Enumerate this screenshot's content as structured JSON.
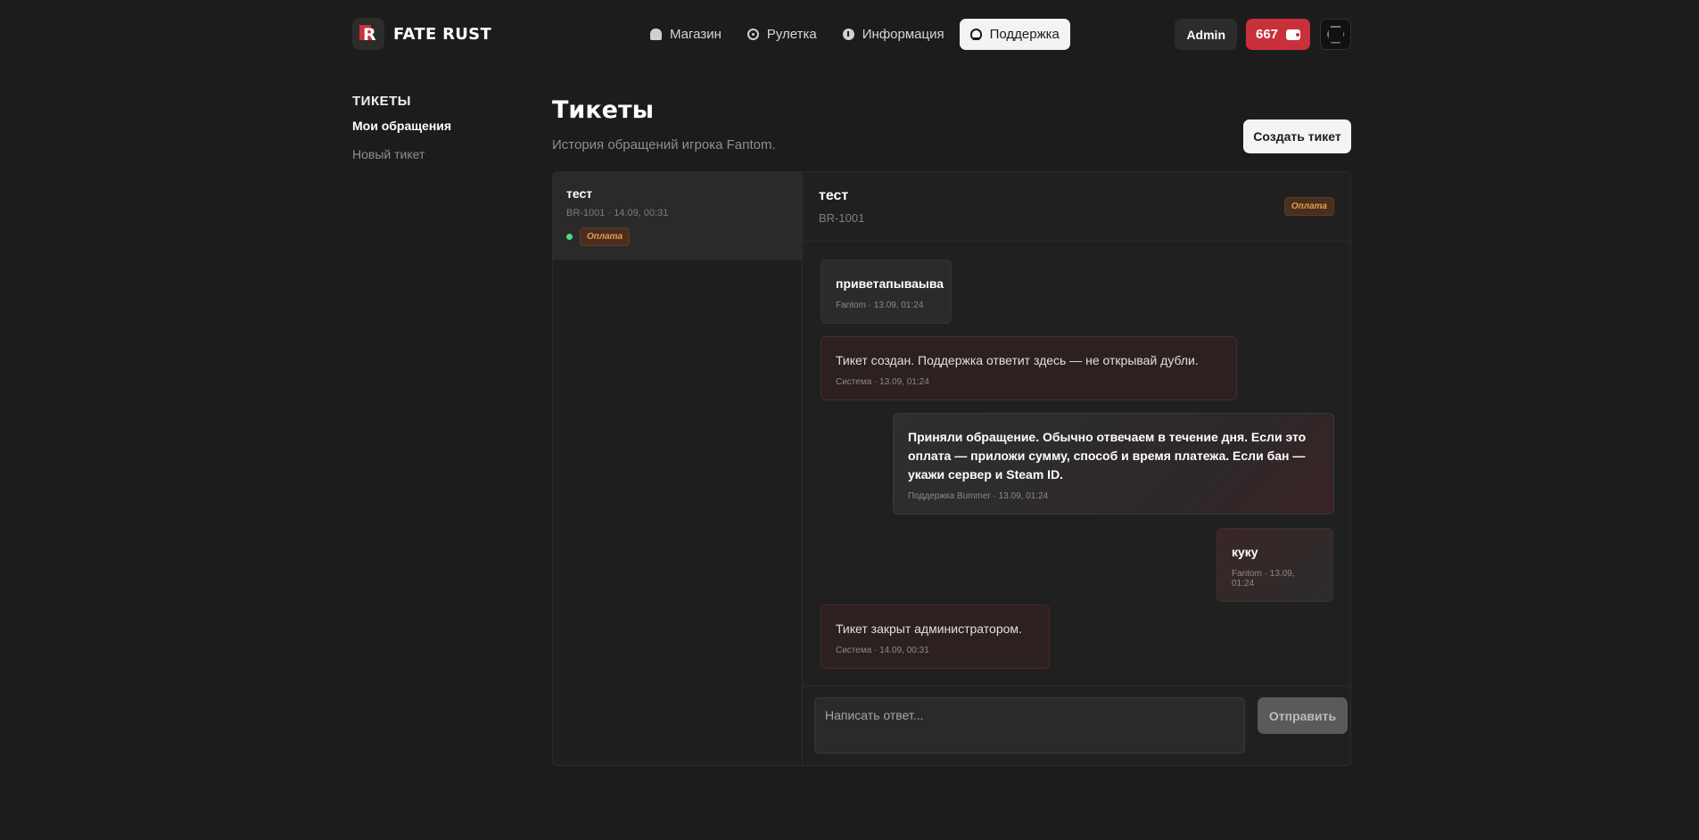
{
  "brand": {
    "name": "FATE RUST",
    "logo_letter": "R"
  },
  "nav": [
    {
      "label": "Магазин",
      "icon": "home-icon"
    },
    {
      "label": "Рулетка",
      "icon": "wheel-icon"
    },
    {
      "label": "Информация",
      "icon": "info-icon"
    },
    {
      "label": "Поддержка",
      "icon": "support-icon",
      "active": true
    }
  ],
  "user": {
    "role_label": "Admin",
    "balance": "667"
  },
  "sidebar": {
    "title": "ТИКЕТЫ",
    "links": [
      "Мои обращения",
      "Новый тикет"
    ]
  },
  "page": {
    "title": "Тикеты",
    "subtitle": "История обращений игрока Fantom.",
    "create_button": "Создать тикет"
  },
  "tickets": [
    {
      "name": "тест",
      "meta": "BR-1001 · 14.09, 00:31",
      "category": "Оплата",
      "status_color": "#4ade80"
    }
  ],
  "chat": {
    "title": "тест",
    "id": "BR-1001",
    "category": "Оплата",
    "messages": [
      {
        "kind": "user",
        "text": "приветапываыва",
        "meta": "Fantom · 13.09, 01:24"
      },
      {
        "kind": "system",
        "text": "Тикет создан. Поддержка ответит здесь — не открывай дубли.",
        "meta": "Система · 13.09, 01:24"
      },
      {
        "kind": "support",
        "text": "Приняли обращение. Обычно отвечаем в течение дня. Если это оплата — приложи сумму, способ и время платежа. Если бан — укажи сервер и Steam ID.",
        "meta": "Поддержка Bummer · 13.09, 01:24"
      },
      {
        "kind": "own",
        "text": "куку",
        "meta": "Fantom · 13.09, 01:24"
      },
      {
        "kind": "system",
        "text": "Тикет закрыт администратором.",
        "meta": "Система · 14.09, 00:31"
      }
    ],
    "reply_placeholder": "Написать ответ...",
    "send_label": "Отправить"
  },
  "colors": {
    "accent": "#c8303a",
    "badge_text": "#e49c4a",
    "online": "#4ade80"
  }
}
